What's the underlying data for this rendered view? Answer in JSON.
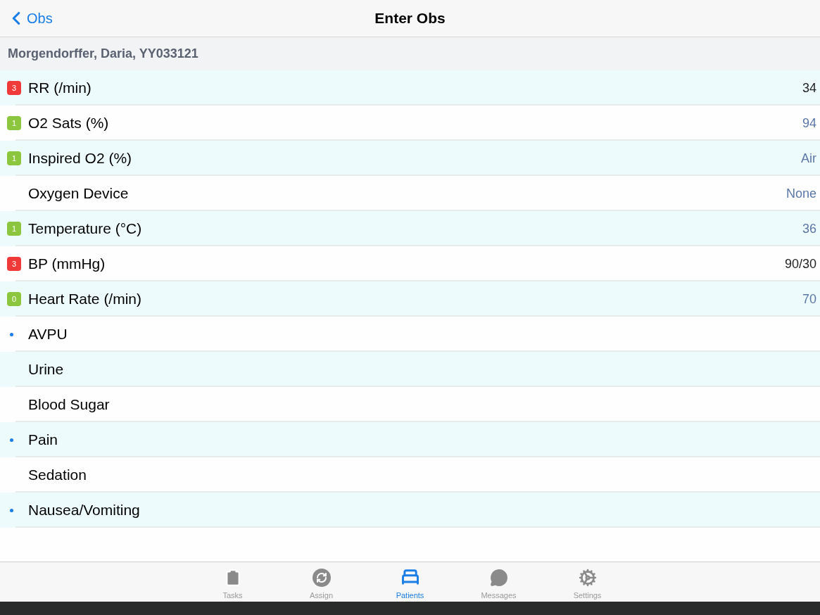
{
  "nav": {
    "back": "Obs",
    "title": "Enter Obs"
  },
  "patient": "Morgendorffer, Daria, YY033121",
  "rows": [
    {
      "label": "RR (/min)",
      "score": "3",
      "color": "#f03a3a",
      "required": false,
      "value": "34",
      "entered": true
    },
    {
      "label": "O2 Sats (%)",
      "score": "1",
      "color": "#8cc63f",
      "required": false,
      "value": "94",
      "entered": false
    },
    {
      "label": "Inspired O2 (%)",
      "score": "1",
      "color": "#8cc63f",
      "required": false,
      "value": "Air",
      "entered": false
    },
    {
      "label": "Oxygen Device",
      "required": false,
      "value": "None",
      "entered": false
    },
    {
      "label": "Temperature (°C)",
      "score": "1",
      "color": "#8cc63f",
      "required": false,
      "value": "36",
      "entered": false
    },
    {
      "label": "BP (mmHg)",
      "score": "3",
      "color": "#f03a3a",
      "required": false,
      "value": "90/30",
      "entered": true
    },
    {
      "label": "Heart Rate (/min)",
      "score": "0",
      "color": "#8cc63f",
      "required": false,
      "value": "70",
      "entered": false
    },
    {
      "label": "AVPU",
      "required": true
    },
    {
      "label": "Urine",
      "required": false
    },
    {
      "label": "Blood Sugar",
      "required": false
    },
    {
      "label": "Pain",
      "required": true
    },
    {
      "label": "Sedation",
      "required": false
    },
    {
      "label": "Nausea/Vomiting",
      "required": true
    }
  ],
  "tabs": [
    {
      "label": "Tasks",
      "selected": false
    },
    {
      "label": "Assign",
      "selected": false
    },
    {
      "label": "Patients",
      "selected": true
    },
    {
      "label": "Messages",
      "selected": false
    },
    {
      "label": "Settings",
      "selected": false
    }
  ]
}
